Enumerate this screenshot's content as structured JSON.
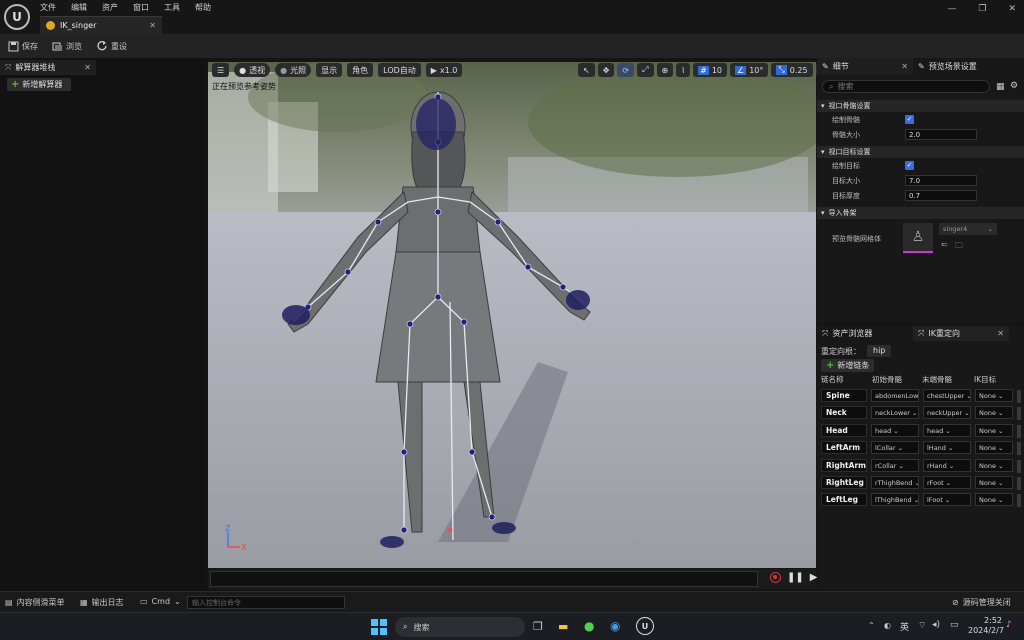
{
  "menu": [
    "文件",
    "编辑",
    "资产",
    "窗口",
    "工具",
    "帮助"
  ],
  "doc_tab": {
    "label": "IK_singer"
  },
  "toolbar": {
    "save": "保存",
    "browse": "浏览",
    "reset": "重设"
  },
  "left_panel": {
    "tab": "解算器堆栈",
    "add_solver": "新增解算器"
  },
  "viewport": {
    "chips": [
      "透视",
      "光照",
      "显示",
      "角色",
      "LOD自动",
      "x1.0"
    ],
    "right_values": {
      "grid": "10",
      "angle": "10°",
      "scale": "0.25",
      "camera": "4"
    },
    "status": "正在预览参考姿势"
  },
  "details": {
    "tab_details": "细节",
    "tab_preview": "预览场景设置",
    "search_placeholder": "搜索",
    "sections": {
      "viewport_bone": "视口骨骼设置",
      "viewport_goal": "视口目标设置",
      "import": "导入骨架"
    },
    "props": {
      "draw_bones": "绘制骨骼",
      "bone_size": "骨骼大小",
      "bone_size_value": "2.0",
      "draw_goals": "绘制目标",
      "goal_size": "目标大小",
      "goal_size_value": "7.0",
      "goal_thickness": "目标厚度",
      "goal_thickness_value": "0.7",
      "preview_mesh": "预览骨骼网格体",
      "mesh_value": "singer4"
    }
  },
  "retarget": {
    "tab_assets": "资产浏览器",
    "tab_ik": "IK重定向",
    "root_label": "重定向根：",
    "root_value": "hip",
    "add_chain": "新增链条",
    "columns": [
      "链名称",
      "初始骨骼",
      "末端骨骼",
      "IK目标"
    ],
    "chains": [
      {
        "name": "Spine",
        "start": "abdomenLowe",
        "end": "chestUpper",
        "goal": "None"
      },
      {
        "name": "Neck",
        "start": "neckLower",
        "end": "neckUpper",
        "goal": "None"
      },
      {
        "name": "Head",
        "start": "head",
        "end": "head",
        "goal": "None"
      },
      {
        "name": "LeftArm",
        "start": "lCollar",
        "end": "lHand",
        "goal": "None"
      },
      {
        "name": "RightArm",
        "start": "rCollar",
        "end": "rHand",
        "goal": "None"
      },
      {
        "name": "RightLeg",
        "start": "rThighBend",
        "end": "rFoot",
        "goal": "None"
      },
      {
        "name": "LeftLeg",
        "start": "lThighBend",
        "end": "lFoot",
        "goal": "None"
      }
    ]
  },
  "statusbar": {
    "content_drawer": "内容侧滑菜单",
    "output_log": "输出日志",
    "cmd": "Cmd",
    "console_placeholder": "输入控制台命令",
    "source_control": "源码管理关闭"
  },
  "taskbar": {
    "search": "搜索",
    "lang": "英",
    "time": "2:52",
    "date": "2024/2/7"
  }
}
